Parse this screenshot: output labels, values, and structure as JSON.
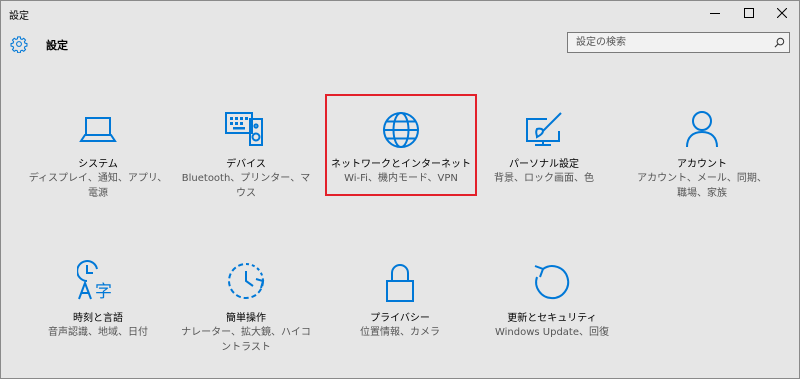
{
  "window": {
    "title": "設定",
    "minimize_icon": "minimize-icon",
    "maximize_icon": "maximize-icon",
    "close_icon": "close-icon"
  },
  "header": {
    "icon": "gear-icon",
    "title": "設定"
  },
  "search": {
    "placeholder": "設定の検索",
    "icon": "search-icon"
  },
  "accent_color": "#0078d7",
  "selection_color": "#e3202a",
  "tiles": [
    {
      "icon": "laptop-icon",
      "label": "システム",
      "desc_line1": "ディスプレイ、通知、アプリ、",
      "desc_line2": "電源",
      "selected": false
    },
    {
      "icon": "keyboard-speaker-icon",
      "label": "デバイス",
      "desc_line1": "Bluetooth、プリンター、マ",
      "desc_line2": "ウス",
      "selected": false
    },
    {
      "icon": "globe-icon",
      "label": "ネットワークとインターネット",
      "desc_line1": "Wi-Fi、機内モード、VPN",
      "desc_line2": "",
      "selected": true
    },
    {
      "icon": "paint-icon",
      "label": "パーソナル設定",
      "desc_line1": "背景、ロック画面、色",
      "desc_line2": "",
      "selected": false
    },
    {
      "icon": "person-icon",
      "label": "アカウント",
      "desc_line1": "アカウント、メール、同期、",
      "desc_line2": "職場、家族",
      "selected": false
    },
    {
      "icon": "clock-language-icon",
      "label": "時刻と言語",
      "desc_line1": "音声認識、地域、日付",
      "desc_line2": "",
      "selected": false
    },
    {
      "icon": "ease-of-access-icon",
      "label": "簡単操作",
      "desc_line1": "ナレーター、拡大鏡、ハイコ",
      "desc_line2": "ントラスト",
      "selected": false
    },
    {
      "icon": "lock-icon",
      "label": "プライバシー",
      "desc_line1": "位置情報、カメラ",
      "desc_line2": "",
      "selected": false
    },
    {
      "icon": "update-icon",
      "label": "更新とセキュリティ",
      "desc_line1": "Windows Update、回復",
      "desc_line2": "",
      "selected": false
    }
  ]
}
